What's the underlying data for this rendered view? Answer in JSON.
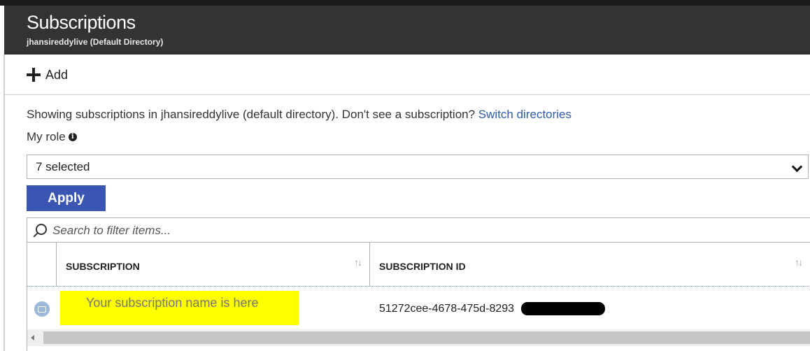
{
  "header": {
    "title": "Subscriptions",
    "subtitle": "jhansireddylive (Default Directory)"
  },
  "toolbar": {
    "add_label": "Add",
    "add_icon": "plus-icon"
  },
  "info": {
    "text": "Showing subscriptions in jhansireddylive (default directory). Don't see a subscription? ",
    "link": "Switch directories"
  },
  "filter": {
    "role_label": "My role",
    "role_info_icon": "info-icon",
    "role_selected": "7 selected",
    "apply_label": "Apply",
    "search_placeholder": "Search to filter items..."
  },
  "table": {
    "columns": [
      {
        "label": "SUBSCRIPTION",
        "sort_icon": "sort-arrows-icon"
      },
      {
        "label": "SUBSCRIPTION ID",
        "sort_icon": "sort-arrows-icon"
      }
    ],
    "rows": [
      {
        "icon": "subscription-key-icon",
        "name": "Your subscription name is here",
        "id": "51272cee-4678-475d-8293"
      }
    ]
  },
  "colors": {
    "header_bg": "#333333",
    "apply_bg": "#3b55b3",
    "link": "#2f5ba8",
    "highlight": "#ffff00"
  }
}
